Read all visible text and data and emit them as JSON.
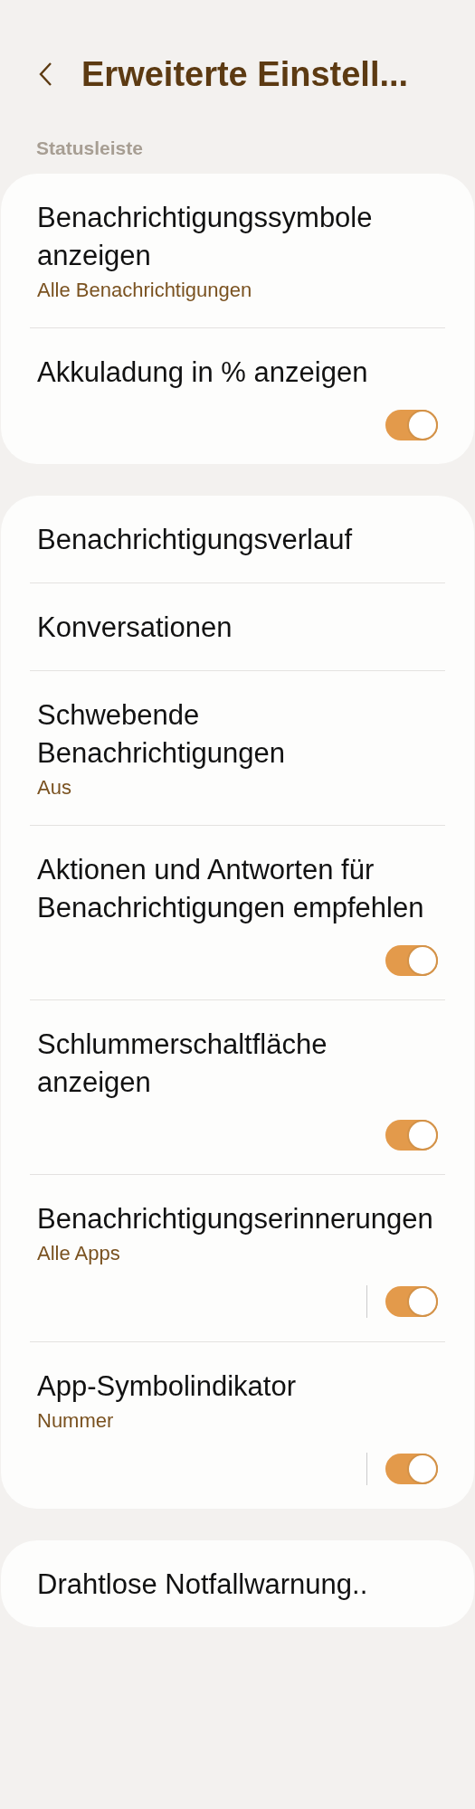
{
  "header": {
    "title": "Erweiterte Einstell..."
  },
  "sections": [
    {
      "label": "Statusleiste",
      "items": [
        {
          "kind": "nav",
          "title": "Benachrichtigungssymbole anzeigen",
          "subtitle": "Alle Benachrichtigungen"
        },
        {
          "kind": "toggle",
          "title": "Akkuladung in % anzeigen",
          "on": true
        }
      ]
    },
    {
      "items": [
        {
          "kind": "nav",
          "title": "Benachrichtigungsverlauf"
        },
        {
          "kind": "nav",
          "title": "Konversationen"
        },
        {
          "kind": "nav",
          "title": "Schwebende Benachrichtigungen",
          "subtitle": "Aus"
        },
        {
          "kind": "toggle",
          "title": "Aktionen und Antworten für Benachrichtigungen empfehlen",
          "on": true
        },
        {
          "kind": "toggle",
          "title": "Schlummerschaltfläche anzeigen",
          "on": true
        },
        {
          "kind": "split-toggle",
          "title": "Benachrichtigungserinnerungen",
          "subtitle": "Alle Apps",
          "on": true
        },
        {
          "kind": "split-toggle",
          "title": "App-Symbolindikator",
          "subtitle": "Nummer",
          "on": true
        }
      ]
    },
    {
      "items": [
        {
          "kind": "nav",
          "title": "Drahtlose Notfallwarnung.."
        }
      ]
    }
  ]
}
